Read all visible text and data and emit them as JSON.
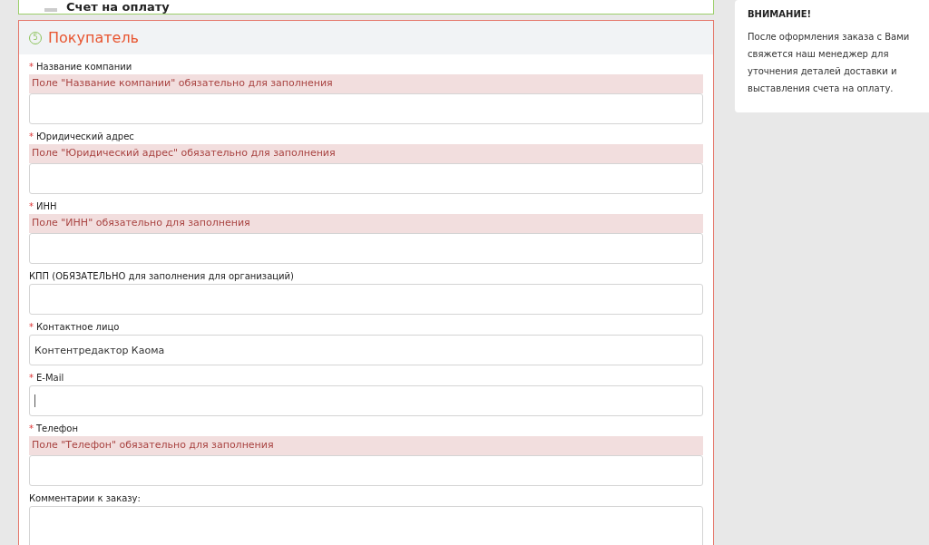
{
  "payment_card": {
    "title": "Счет на оплату"
  },
  "buyer": {
    "step": "5",
    "title": "Покупатель",
    "fields": [
      {
        "kind": "input",
        "label": "Название компании",
        "required_mark": "*",
        "error": "Поле \"Название компании\" обязательно для заполнения"
      },
      {
        "kind": "input",
        "label": "Юридический адрес",
        "required_mark": "*",
        "error": "Поле \"Юридический адрес\" обязательно для заполнения"
      },
      {
        "kind": "input",
        "label": "ИНН",
        "required_mark": "*",
        "error": "Поле \"ИНН\" обязательно для заполнения"
      },
      {
        "kind": "input",
        "label": "КПП (ОБЯЗАТЕЛЬНО для заполнения для организаций)"
      },
      {
        "kind": "input",
        "label": "Контактное лицо",
        "required_mark": "*",
        "value": "Контентредактор Каома"
      },
      {
        "kind": "input",
        "label": "E-Mail",
        "required_mark": "*",
        "focused": true
      },
      {
        "kind": "input",
        "label": "Телефон",
        "required_mark": "*",
        "error": "Поле \"Телефон\" обязательно для заполнения"
      },
      {
        "kind": "textarea",
        "label": "Комментарии к заказу:"
      }
    ]
  },
  "notice": {
    "title": "ВНИМАНИЕ!",
    "text": "После оформления заказа с Вами свяжется наш менеджер для уточнения деталей доставки и выставления счета на оплату."
  }
}
